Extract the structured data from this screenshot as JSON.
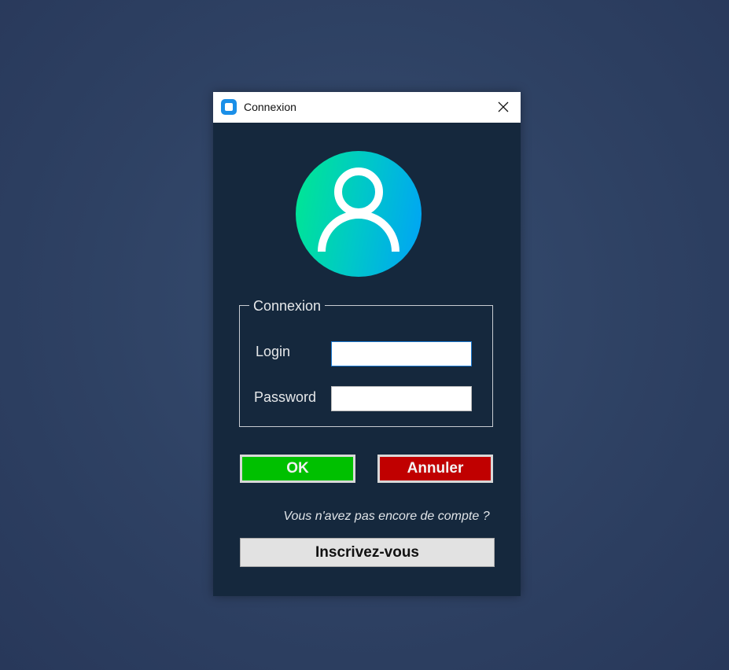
{
  "window": {
    "title": "Connexion",
    "app_icon": "app-icon",
    "close_icon": "close-icon"
  },
  "avatar": {
    "icon": "user-icon",
    "gradient": [
      "#00e890",
      "#00a2f8"
    ]
  },
  "group": {
    "legend": "Connexion",
    "login_label": "Login",
    "login_value": "",
    "password_label": "Password",
    "password_value": ""
  },
  "buttons": {
    "ok": "OK",
    "cancel": "Annuler",
    "register": "Inscrivez-vous"
  },
  "prompt": "Vous n'avez pas encore de compte ?",
  "colors": {
    "ok": "#00c000",
    "cancel": "#c00000",
    "body": "#15283d"
  }
}
